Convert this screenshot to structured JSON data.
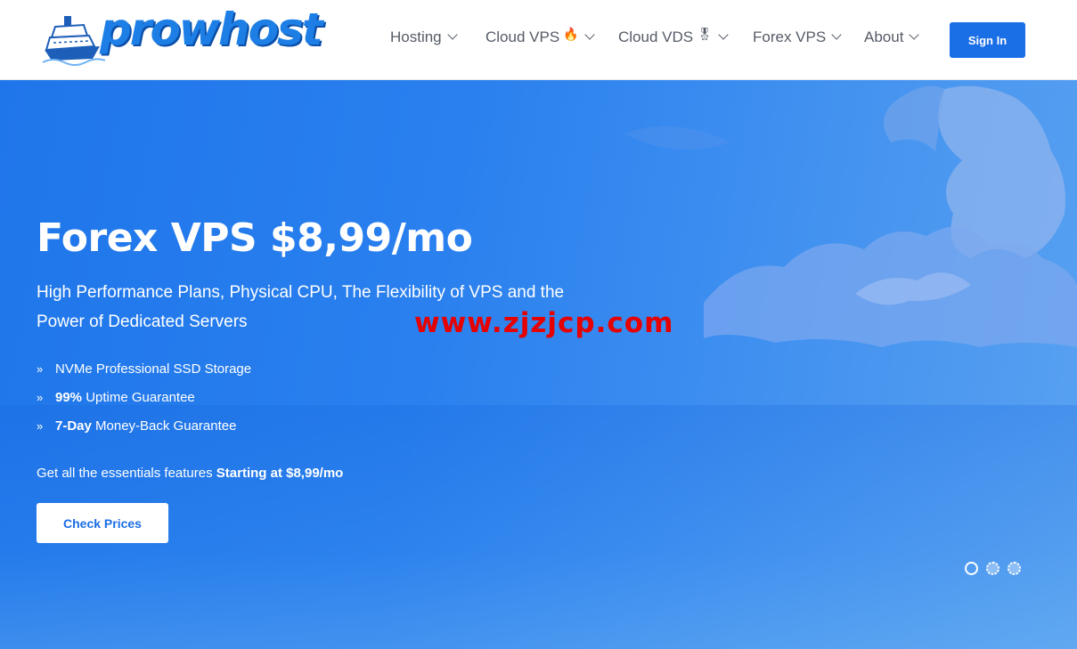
{
  "header": {
    "logo_text": "prowhost",
    "nav": [
      {
        "label": "Hosting",
        "badge": ""
      },
      {
        "label": "Cloud VPS",
        "badge": "🔥"
      },
      {
        "label": "Cloud VDS",
        "badge": "🎖"
      },
      {
        "label": "Forex VPS",
        "badge": ""
      },
      {
        "label": "About",
        "badge": ""
      }
    ],
    "signin_label": "Sign In"
  },
  "hero": {
    "title": "Forex VPS $8,99/mo",
    "subtitle": "High Performance Plans, Physical CPU, The Flexibility of VPS and the Power of Dedicated Servers",
    "watermark": "www.zjzjcp.com",
    "features": [
      {
        "bold": "",
        "text": "NVMe Professional SSD Storage"
      },
      {
        "bold": "99%",
        "text": " Uptime Guarantee"
      },
      {
        "bold": "7-Day",
        "text": " Money-Back Guarantee"
      }
    ],
    "essentials_text": "Get all the essentials features ",
    "essentials_bold": "Starting at $8,99/mo",
    "cta_label": "Check Prices",
    "slides_total": 3,
    "active_slide": 1
  },
  "colors": {
    "brand": "#1a6ee6",
    "hero_bg": "#2a80ee",
    "watermark": "#e60000"
  }
}
